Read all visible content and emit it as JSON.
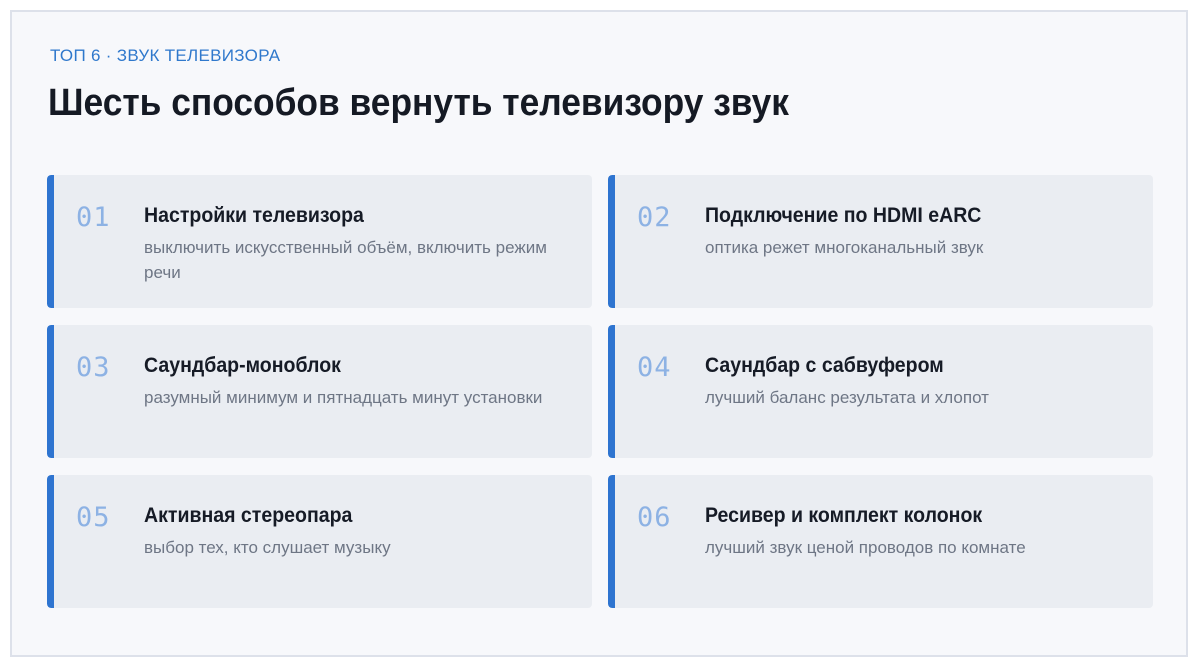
{
  "header": {
    "eyebrow": "ТОП 6 · ЗВУК ТЕЛЕВИЗОРА",
    "title": "Шесть способов вернуть телевизору звук"
  },
  "items": [
    {
      "num": "01",
      "title": "Настройки телевизора",
      "desc": "выключить искусственный объём, включить режим речи"
    },
    {
      "num": "02",
      "title": "Подключение по HDMI eARC",
      "desc": "оптика режет многоканальный звук"
    },
    {
      "num": "03",
      "title": "Саундбар-моноблок",
      "desc": "разумный минимум и пятнадцать минут установки"
    },
    {
      "num": "04",
      "title": "Саундбар с сабвуфером",
      "desc": "лучший баланс результата и хлопот"
    },
    {
      "num": "05",
      "title": "Активная стереопара",
      "desc": "выбор тех, кто слушает музыку"
    },
    {
      "num": "06",
      "title": "Ресивер и комплект колонок",
      "desc": "лучший звук ценой проводов по комнате"
    }
  ],
  "colors": {
    "accent": "#2e74d0",
    "number": "#8db2e4",
    "card_bg": "#eaedf2",
    "page_bg": "#f7f8fb"
  }
}
